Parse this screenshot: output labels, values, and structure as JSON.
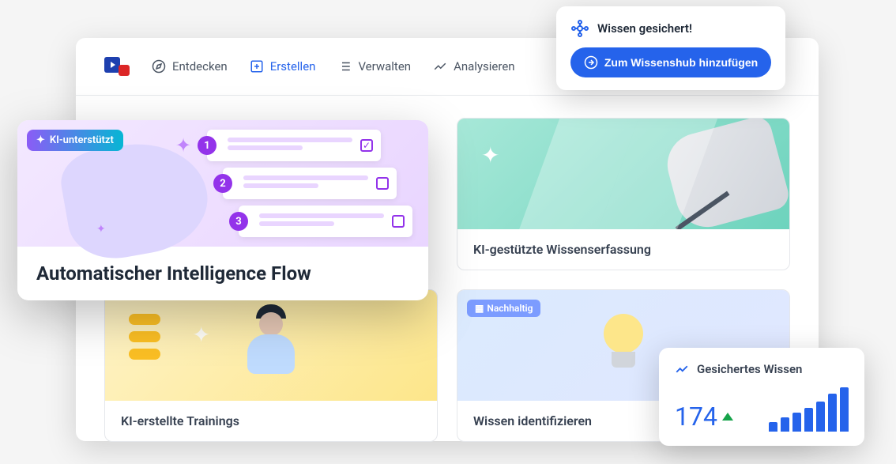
{
  "nav": {
    "discover": "Entdecken",
    "create": "Erstellen",
    "manage": "Verwalten",
    "analyze": "Analysieren"
  },
  "feature_card": {
    "badge": "KI-unterstützt",
    "title": "Automatischer Intelligence Flow",
    "steps": [
      "1",
      "2",
      "3"
    ]
  },
  "cards": {
    "knowledge_capture": "KI-gestützte Wissenserfassung",
    "trainings": "KI-erstellte Trainings",
    "identify": "Wissen identifizieren",
    "identify_badge": "Nachhaltig"
  },
  "notification": {
    "title": "Wissen gesichert!",
    "button": "Zum Wissenshub hinzufügen"
  },
  "stats": {
    "title": "Gesichertes Wissen",
    "value": "174",
    "bars": [
      12,
      18,
      24,
      30,
      38,
      48,
      56
    ]
  },
  "colors": {
    "primary": "#2563eb",
    "purple": "#9333ea"
  }
}
